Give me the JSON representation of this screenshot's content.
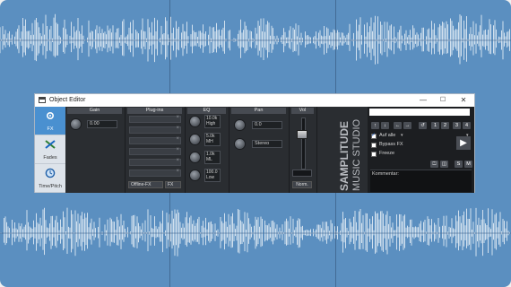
{
  "window": {
    "title": "Object Editor",
    "minimize": "—",
    "maximize": "☐",
    "close": "✕"
  },
  "tabs": [
    {
      "label": "FX",
      "icon": "fx-gear-icon",
      "active": true
    },
    {
      "label": "Fades",
      "icon": "fades-cross-icon",
      "active": false
    },
    {
      "label": "Time/Pitch",
      "icon": "time-pitch-clock-icon",
      "active": false
    }
  ],
  "sections": {
    "gain": {
      "header": "Gain",
      "value": "0.00"
    },
    "plugins": {
      "header": "Plug-ins",
      "offline_label": "Offline-FX",
      "fx_label": "FX"
    },
    "eq": {
      "header": "EQ",
      "bands": [
        {
          "value": "10.0k",
          "name": "High"
        },
        {
          "value": "5.0k",
          "name": "MH"
        },
        {
          "value": "1.0k",
          "name": "ML"
        },
        {
          "value": "100.0",
          "name": "Low"
        }
      ]
    },
    "pan": {
      "header": "Pan",
      "value": "0.0",
      "mode": "Stereo"
    },
    "vol": {
      "header": "Vol",
      "norm_label": "Norm.",
      "level": 0.7
    }
  },
  "brand": {
    "line1": "SAMPLITUDE",
    "line2": "MUSIC STUDIO"
  },
  "right_panel": {
    "nav_up": "↑",
    "nav_down": "↓",
    "nav_left": "←",
    "nav_right": "→",
    "undo": "↺",
    "slots": [
      "1",
      "2",
      "3",
      "4"
    ],
    "apply_all": "Auf alle",
    "bypass": "Bypass FX",
    "freeze": "Freeze",
    "play": "▶",
    "comment_label": "Kommentar:",
    "s_label": "S",
    "m_label": "M"
  },
  "colors": {
    "background": "#5b8fc0",
    "accent": "#4a90d0",
    "panel": "#2a2d31"
  }
}
